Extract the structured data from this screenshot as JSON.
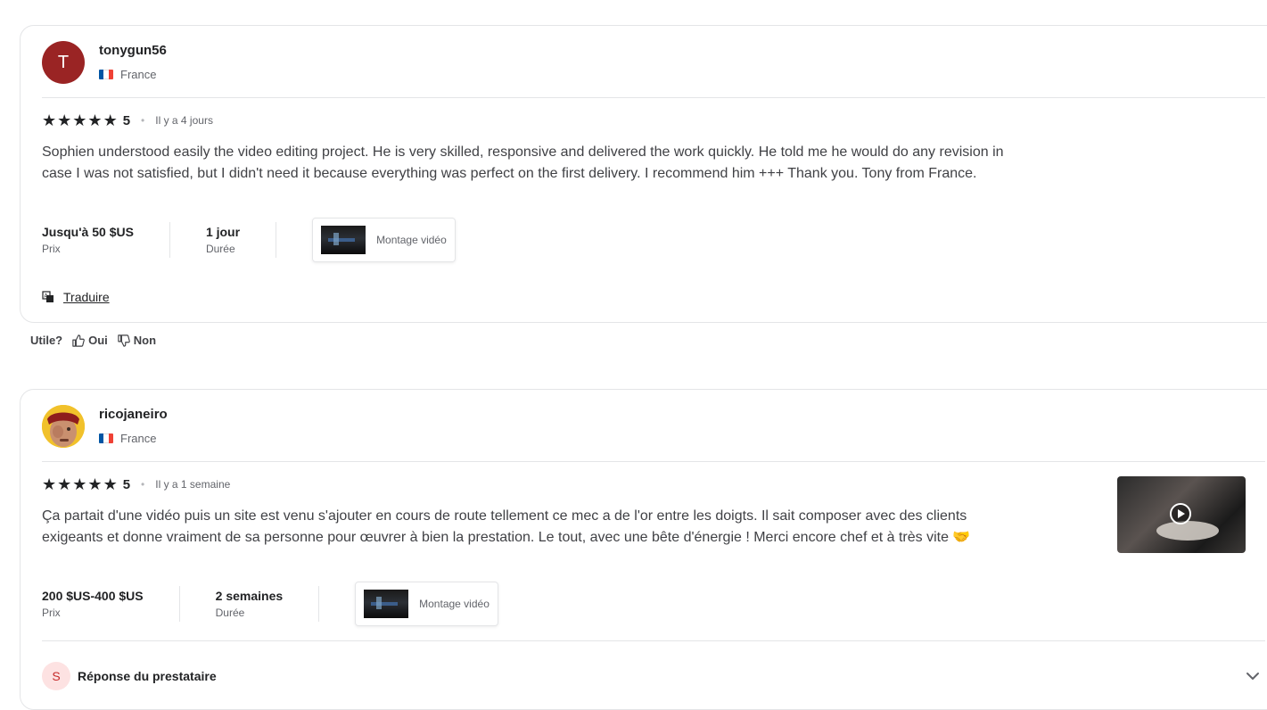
{
  "reviews": [
    {
      "avatar_letter": "T",
      "avatar_color": "#9a2424",
      "username": "tonygun56",
      "country": "France",
      "stars": [
        "★",
        "★",
        "★",
        "★",
        "★"
      ],
      "rating": "5",
      "time_ago": "Il y a 4 jours",
      "text": "Sophien understood easily the video editing project. He is very skilled, responsive and delivered the work quickly. He told me he would do any revision in case I was not satisfied, but I didn't need it because everything was perfect on the first delivery. I recommend him +++ Thank you. Tony from France.",
      "price_value": "Jusqu'à 50 $US",
      "price_label": "Prix",
      "duration_value": "1 jour",
      "duration_label": "Durée",
      "service": "Montage vidéo",
      "translate": "Traduire"
    },
    {
      "username": "ricojaneiro",
      "country": "France",
      "stars": [
        "★",
        "★",
        "★",
        "★",
        "★"
      ],
      "rating": "5",
      "time_ago": "Il y a 1 semaine",
      "text": "Ça partait d'une vidéo puis un site est venu s'ajouter en cours de route tellement ce mec a de l'or entre les doigts. Il sait composer avec des clients exigeants et donne vraiment de sa personne pour œuvrer à bien la prestation. Le tout, avec une bête d'énergie ! Merci encore chef et à très vite 🤝",
      "price_value": "200 $US-400 $US",
      "price_label": "Prix",
      "duration_value": "2 semaines",
      "duration_label": "Durée",
      "service": "Montage vidéo",
      "seller_initial": "S",
      "response_label": "Réponse du prestataire"
    }
  ],
  "helpful": {
    "question": "Utile?",
    "yes": "Oui",
    "no": "Non"
  },
  "icons": {
    "thumbs_up": "thumbs-up-icon",
    "thumbs_down": "thumbs-down-icon",
    "translate": "translate-icon",
    "chevron": "chevron-down-icon",
    "play": "play-icon"
  }
}
